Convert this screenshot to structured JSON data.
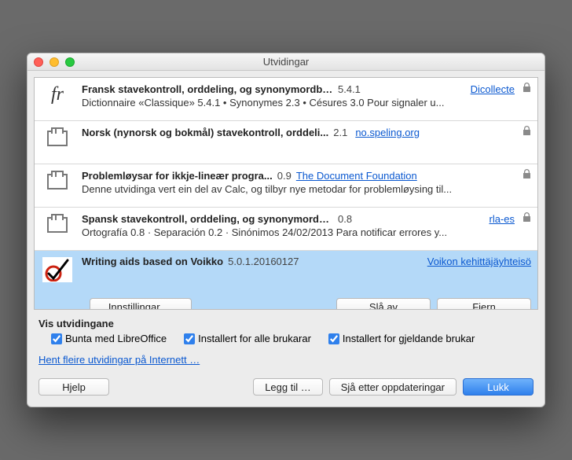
{
  "window": {
    "title": "Utvidingar"
  },
  "extensions": [
    {
      "name": "Fransk stavekontroll, orddeling, og synonymordbok",
      "version": "5.4.1",
      "link": "Dicollecte",
      "locked": true,
      "desc": "Dictionnaire «Classique» 5.4.1 • Synonymes 2.3 • Césures 3.0   Pour signaler u..."
    },
    {
      "name": "Norsk (nynorsk og bokmål) stavekontroll, orddeli...",
      "version": "2.1",
      "link": "no.speling.org",
      "locked": true,
      "desc": ""
    },
    {
      "name": "Problemløysar for ikkje-lineær progra...",
      "version": "0.9",
      "link": "The Document Foundation",
      "locked": true,
      "desc": "Denne utvidinga vert ein del av Calc, og tilbyr nye metodar for problemløysing til..."
    },
    {
      "name": "Spansk stavekontroll, orddeling, og synonymordbok",
      "version": "0.8",
      "link": "rla-es",
      "locked": true,
      "desc": "Ortografía 0.8 · Separación 0.2 · Sinónimos 24/02/2013  Para notificar errores y..."
    },
    {
      "name": "Writing aids based on Voikko",
      "version": "5.0.1.20160127",
      "link": "Voikon kehittäjäyhteisö",
      "locked": false,
      "desc": ""
    }
  ],
  "row_buttons": {
    "settings": "Innstillingar …",
    "disable": "Slå av",
    "remove": "Fjern"
  },
  "filter": {
    "title": "Vis utvidingane",
    "bundled": "Bunta med  LibreOffice",
    "all_users": "Installert for alle brukarar",
    "current_user": "Installert for gjeldande brukar"
  },
  "more_link": "Hent fleire utvidingar på Internett …",
  "footer": {
    "help": "Hjelp",
    "add": "Legg til …",
    "check_updates": "Sjå etter oppdateringar",
    "close": "Lukk"
  }
}
